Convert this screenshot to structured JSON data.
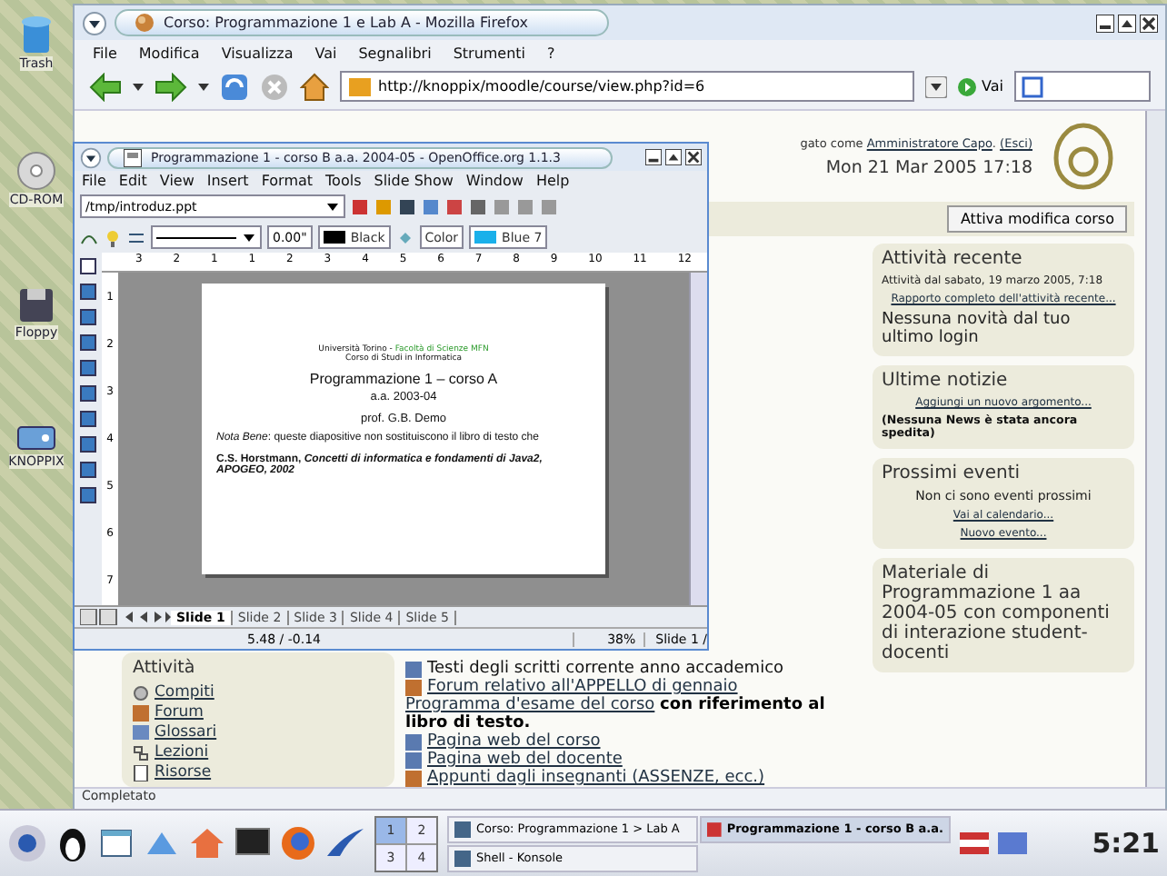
{
  "desktop_icons": [
    {
      "label": "Trash",
      "kind": "trash"
    },
    {
      "label": "CD-ROM",
      "kind": "disc"
    },
    {
      "label": "Floppy",
      "kind": "floppy"
    },
    {
      "label": "KNOPPIX",
      "kind": "drive"
    }
  ],
  "browser": {
    "title": "Corso: Programmazione 1 e Lab A - Mozilla Firefox",
    "menu": [
      "File",
      "Modifica",
      "Visualizza",
      "Vai",
      "Segnalibri",
      "Strumenti",
      "?"
    ],
    "url": "http://knoppix/moodle/course/view.php?id=6",
    "go": "Vai",
    "login": {
      "prefix": "gato come",
      "user": "Amministratore Capo",
      "separator": ".",
      "logout": "(Esci)"
    },
    "date": "Mon 21 Mar 2005 17:18",
    "edit_button": "Attiva modifica corso",
    "activity_block": {
      "title": "Attività",
      "items": [
        {
          "label": "Compiti",
          "kind": "assignment"
        },
        {
          "label": "Forum",
          "kind": "forum"
        },
        {
          "label": "Glossari",
          "kind": "glossary"
        },
        {
          "label": "Lezioni",
          "kind": "lesson"
        },
        {
          "label": "Risorse",
          "kind": "resource"
        }
      ]
    },
    "main_items": [
      {
        "kind": "web",
        "linked": false,
        "text": "Testi degli scritti corrente anno accademico"
      },
      {
        "kind": "forum",
        "linked": true,
        "text": "Forum relativo all'APPELLO di gennaio"
      },
      {
        "kind": "note",
        "linked": true,
        "text": "Programma d'esame del corso",
        "extra": "con riferimento al libro di testo."
      },
      {
        "kind": "web",
        "linked": true,
        "text": "Pagina web del corso"
      },
      {
        "kind": "web",
        "linked": true,
        "text": "Pagina web del docente"
      },
      {
        "kind": "forum",
        "linked": true,
        "text": "Appunti dagli insegnanti (ASSENZE, ecc.)"
      }
    ],
    "side_blocks": [
      {
        "title": "Attività recente",
        "lines": [
          {
            "kind": "small",
            "text": "Attività dal sabato, 19 marzo 2005, 7:18"
          },
          {
            "kind": "link",
            "text": "Rapporto completo dell'attività recente..."
          },
          {
            "kind": "large",
            "text": "Nessuna novità dal tuo ultimo login"
          }
        ]
      },
      {
        "title": "Ultime notizie",
        "lines": [
          {
            "kind": "link",
            "text": "Aggiungi un nuovo argomento..."
          },
          {
            "kind": "bold",
            "text": "(Nessuna News è stata ancora spedita)"
          }
        ]
      },
      {
        "title": "Prossimi eventi",
        "lines": [
          {
            "kind": "center",
            "text": "Non ci sono eventi prossimi"
          },
          {
            "kind": "link",
            "text": "Vai al calendario..."
          },
          {
            "kind": "link",
            "text": "Nuovo evento..."
          }
        ]
      },
      {
        "title": "Materiale di Programmazione 1 aa 2004-05 con componenti di interazione student-docenti"
      }
    ],
    "status": "Completato"
  },
  "office": {
    "title": "Programmazione 1 - corso B a.a. 2004-05 - OpenOffice.org 1.1.3",
    "menu": [
      "File",
      "Edit",
      "View",
      "Insert",
      "Format",
      "Tools",
      "Slide Show",
      "Window",
      "Help"
    ],
    "path": "/tmp/introduz.ppt",
    "line_width": "0.00\"",
    "line_color": "Black",
    "area_style": "Color",
    "area_color": "Blue 7",
    "ruler": [
      "3",
      "2",
      "1",
      "1",
      "2",
      "3",
      "4",
      "5",
      "6",
      "7",
      "8",
      "9",
      "10",
      "11",
      "12"
    ],
    "vruler": [
      "1",
      "2",
      "3",
      "4",
      "5",
      "6",
      "7"
    ],
    "slide": {
      "institution": "Università Torino -",
      "faculty": "Facoltà di Scienze MFN",
      "department": "Corso di Studi in Informatica",
      "heading": "Programmazione 1 – corso A",
      "year": "a.a. 2003-04",
      "author": "prof. G.B. Demo",
      "note": "*Nota Bene*: queste diapositive non sostituiscono il libro di testo che",
      "reference": "C.S. Horstmann, *Concetti di informatica e fondamenti di Java2, APOGEO, 2002*"
    },
    "tabs": [
      {
        "label": "Slide 1",
        "selected": true
      },
      {
        "label": "Slide 2",
        "selected": false
      },
      {
        "label": "Slide 3",
        "selected": false
      },
      {
        "label": "Slide 4",
        "selected": false
      },
      {
        "label": "Slide 5",
        "selected": false
      }
    ],
    "position": "5.48 / -0.14",
    "zoom": "38%",
    "page": "Slide 1 /"
  },
  "taskbar": {
    "pager": [
      {
        "label": "1",
        "selected": true
      },
      {
        "label": "2",
        "selected": false
      },
      {
        "label": "3",
        "selected": false
      },
      {
        "label": "4",
        "selected": false
      }
    ],
    "tasks": [
      {
        "label": "Corso: Programmazione 1 > Lab A",
        "selected": false
      },
      {
        "label": "Shell - Konsole",
        "selected": false
      },
      {
        "label": "Programmazione 1 - corso B a.a.",
        "selected": true
      }
    ],
    "clock": "5:21"
  }
}
